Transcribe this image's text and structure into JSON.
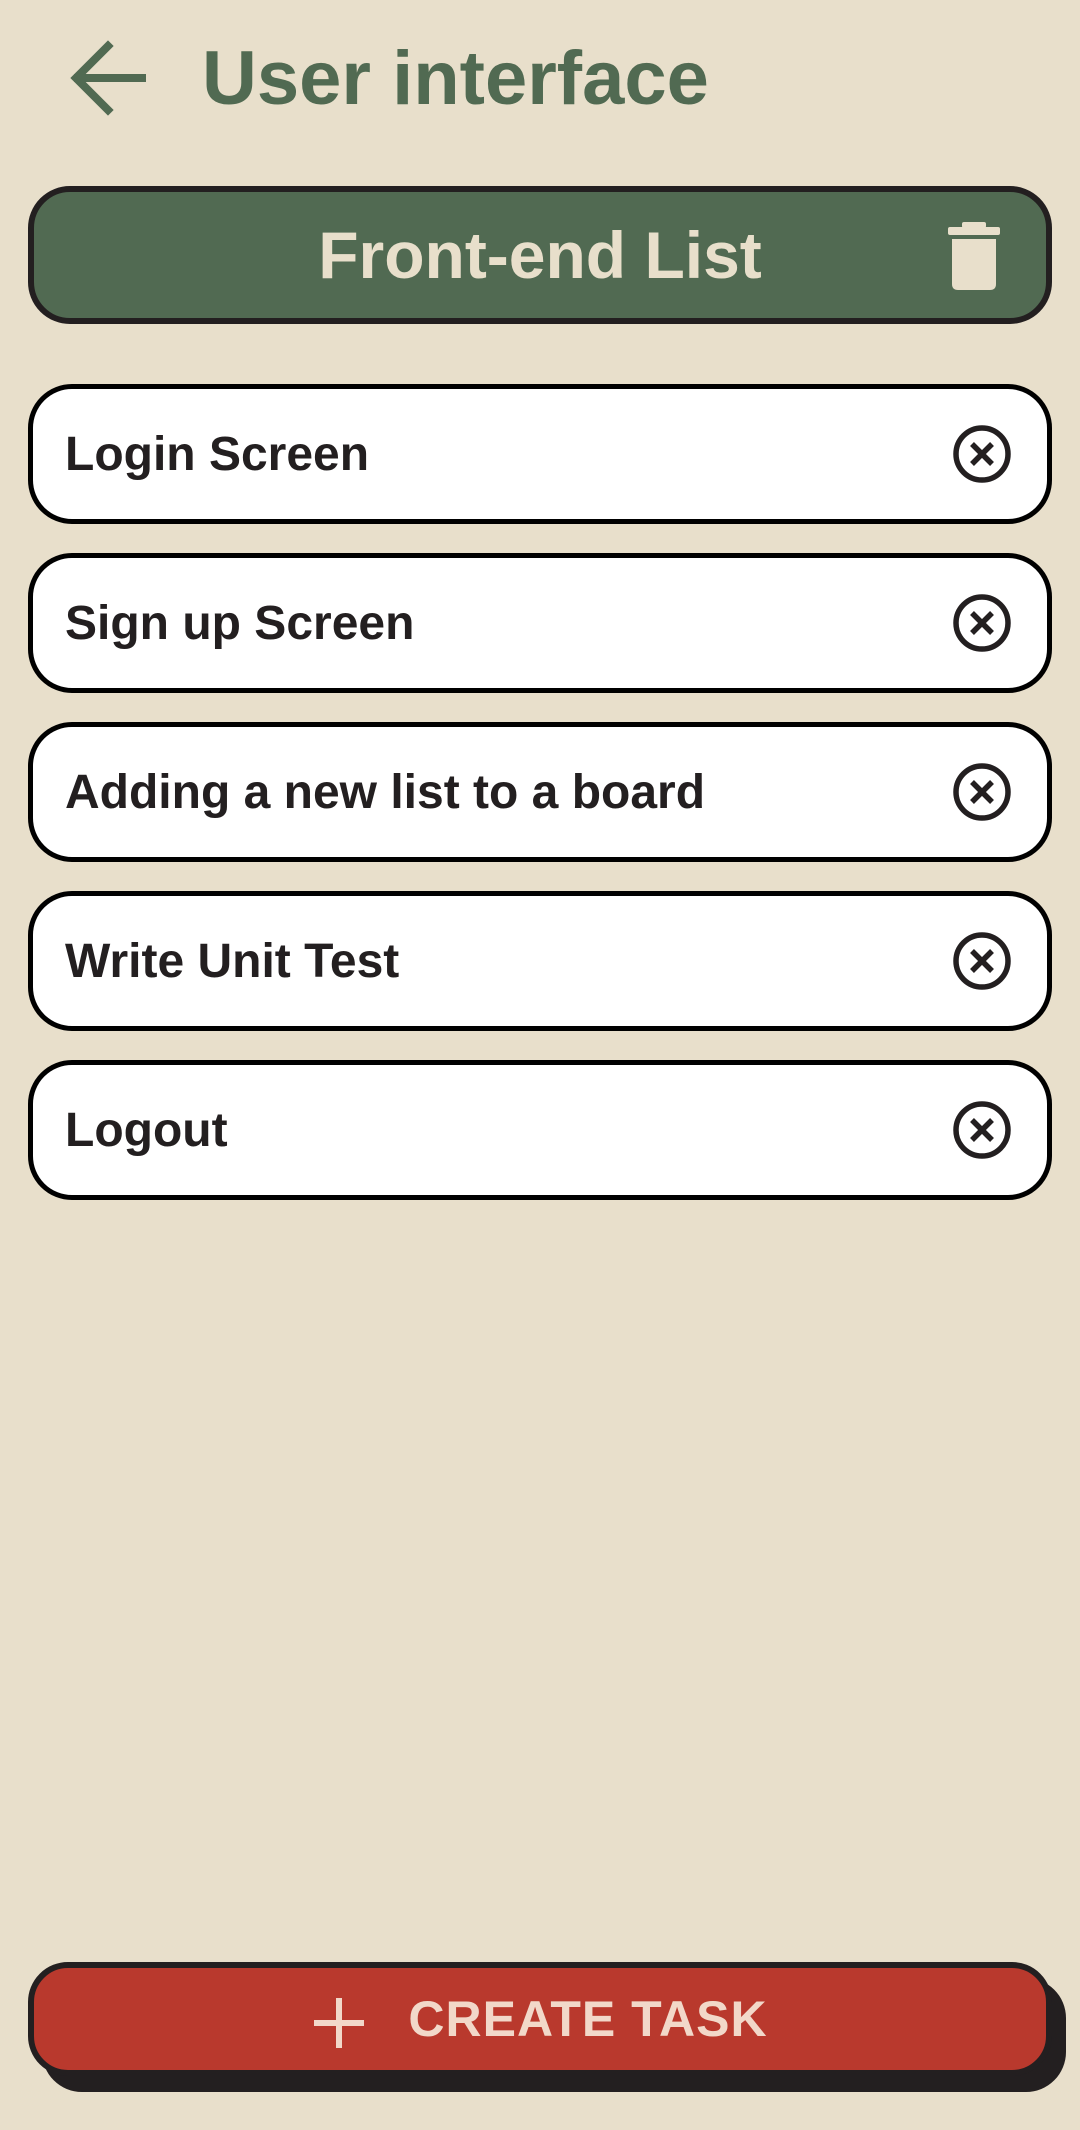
{
  "header": {
    "title": "User interface",
    "back_icon": "arrow-left-icon"
  },
  "list": {
    "title": "Front-end List",
    "delete_icon": "trash-icon"
  },
  "tasks": [
    {
      "label": "Login Screen",
      "remove_icon": "close-circle-icon"
    },
    {
      "label": "Sign up Screen",
      "remove_icon": "close-circle-icon"
    },
    {
      "label": "Adding a new list to a board",
      "remove_icon": "close-circle-icon"
    },
    {
      "label": "Write Unit Test",
      "remove_icon": "close-circle-icon"
    },
    {
      "label": "Logout",
      "remove_icon": "close-circle-icon"
    }
  ],
  "create_button": {
    "label": "CREATE TASK",
    "icon": "plus-icon"
  },
  "colors": {
    "background": "#E8DFCB",
    "primary_green": "#516A52",
    "accent_red": "#B9392D",
    "card": "#FFFFFF",
    "outline": "#231F20",
    "light_text": "#E8DFCB"
  }
}
